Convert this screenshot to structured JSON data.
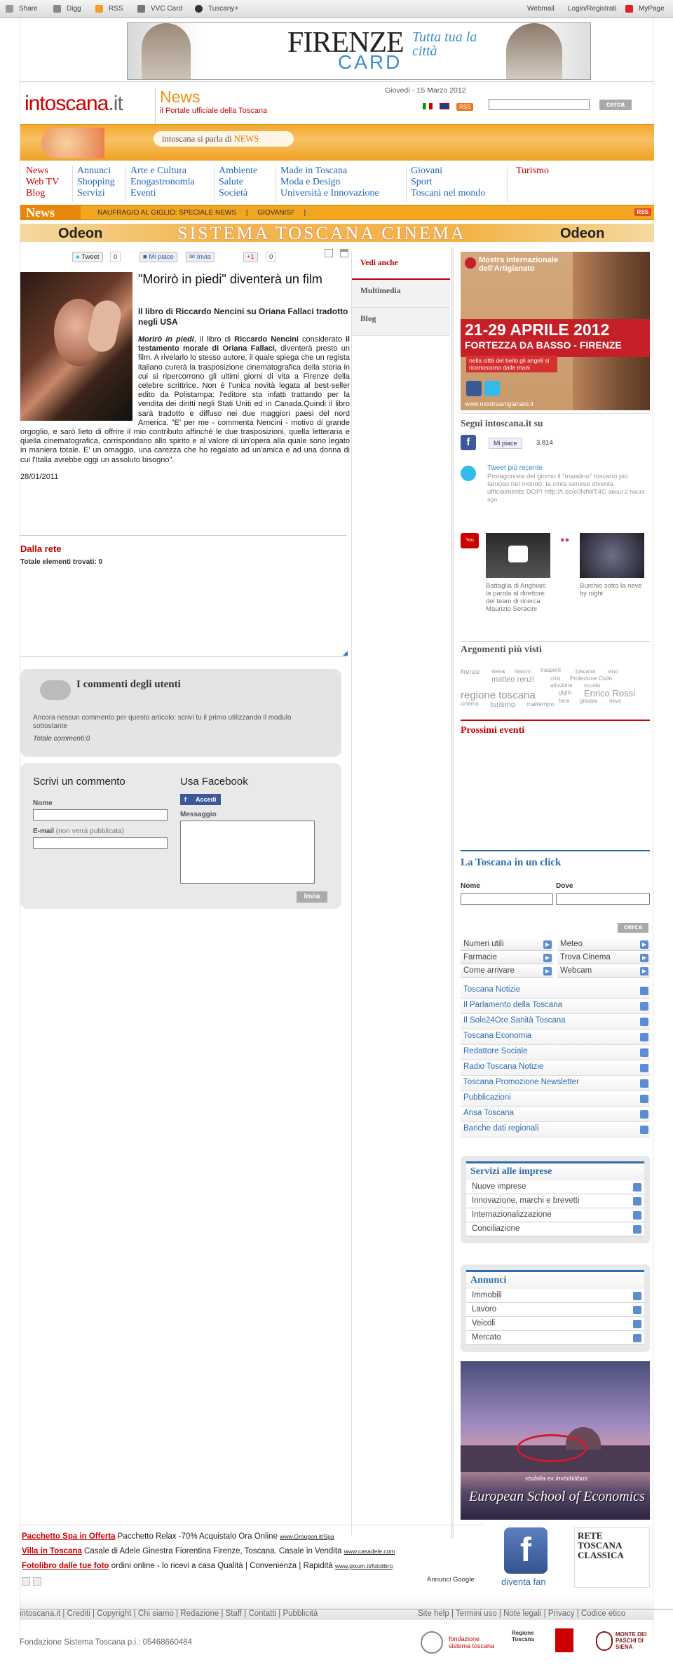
{
  "topbar": {
    "share": "Share",
    "digg": "Digg",
    "rss": "RSS",
    "vvc": "VVC Card",
    "tuscany": "Tuscany+",
    "webmail": "Webmail",
    "login": "Login/Registrati",
    "mypage": "MyPage"
  },
  "banner": {
    "firenze": "FIRENZE",
    "card": "CARD",
    "slogan": "Tutta tua la città"
  },
  "header": {
    "logo_main": "intoscana",
    "logo_tld": ".it",
    "news": "News",
    "subtitle": "il Portale ufficiale della Toscana",
    "date": "Giovedì - 15 Marzo 2012",
    "rss": "RSS",
    "search_button": "cerca"
  },
  "parla": {
    "pre": "intoscana si parla di ",
    "hl": "NEWS"
  },
  "nav": {
    "c1": [
      "News",
      "Web TV",
      "Blog"
    ],
    "c2": [
      "Annunci",
      "Shopping",
      "Servizi"
    ],
    "c3": [
      "Arte e Cultura",
      "Enogastronomia",
      "Eventi"
    ],
    "c4": [
      "Ambiente",
      "Salute",
      "Società"
    ],
    "c5": [
      "Made in Toscana",
      "Moda e Design",
      "Università e Innovazione"
    ],
    "c6": [
      "Giovani",
      "Sport",
      "Toscani nel mondo"
    ],
    "c7": [
      "Turismo"
    ]
  },
  "newsbar": {
    "label": "News",
    "ticker": "NAUFRAGIO AL GIGLIO: SPECIALE NEWS     |     GIOVANISI'     |",
    "rss": "RSS"
  },
  "cinema": {
    "text": "SISTEMA TOSCANA CINEMA",
    "odeon": "Odeon"
  },
  "share": {
    "tweet": "Tweet",
    "tweet_count": "0",
    "like": "Mi piace",
    "invia": "Invia",
    "gplus": "+1",
    "gplus_count": "0"
  },
  "article": {
    "title": "\"Morirò in piedi\" diventerà un film",
    "subtitle": "Il libro di Riccardo Nencini su Oriana Fallaci tradotto negli USA",
    "body_em": "Morirò in piedi",
    "body_1": ", il libro di ",
    "body_b1": "Riccardo Nencini",
    "body_2": " considerato ",
    "body_b2": "il testamento morale di Oriana Fallaci,",
    "body_3": " diventerà presto un film. A rivelarlo lo stesso autore, il quale spiega che un regista italiano curerà la trasposizione cinematografica della storia in cui si ripercorrono gli ultimi giorni di vita a Firenze della celebre scrittrice. Non è l'unica novità legata al best-seller edito da Polistampa: l'editore sta infatti trattando per la vendita dei diritti negli Stati Uniti ed in Canada.Quindi il libro sarà tradotto e diffuso nei due maggiori paesi del nord America. \"E' per me - commenta Nencini - motivo di grande orgoglio, e sarò lieto di offrire il mio contributo affinché le due trasposizioni, quella letteraria e quella cinematografica, corrispondano allo spirito e al valore di un'opera alla quale sono legato in maniera totale. E' un omaggio, una carezza che ho regalato ad un'amica e ad una donna di cui l'Italia avrebbe oggi un assoluto bisogno\".",
    "date": "28/01/2011"
  },
  "dallarete": {
    "title": "Dalla rete",
    "total": "Totale elementi trovati: 0"
  },
  "comments": {
    "title": "I commenti degli utenti",
    "empty": "Ancora nessun commento per questo articolo: scrivi tu il primo utilizzando il modulo sottostante",
    "total": "Totale commenti:0"
  },
  "form": {
    "title": "Scrivi un commento",
    "name": "Nome",
    "email": "E-mail",
    "email_note": " (non verrà pubblicata)",
    "fb_title": "Usa Facebook",
    "fb_btn": "Accedi",
    "msg": "Messaggio",
    "send": "Invia"
  },
  "midtabs": [
    "Vedi anche",
    "Multimedia",
    "Blog"
  ],
  "adArt": {
    "top": "Mostra Internazionale dell'Artigianato",
    "dates": "21-29 APRILE 2012",
    "place": "FORTEZZA DA BASSO - FIRENZE",
    "sub": "nella città del bello gli angeli si riconoscono dalle mani",
    "url": "www.mostraartigianato.it"
  },
  "segui": {
    "title": "Segui intoscana.it su",
    "like": "Mi piace",
    "count": "3,814",
    "tw_head": "Tweet più recente",
    "tw_text": "Protagonista del giorno il \"maialino\" toscano più famoso nel mondo: la cinta senese diventa ufficialmente DOP! http://t.co/c0NtWT4C",
    "tw_time": "about 2 hours ago"
  },
  "yt": {
    "logo": "You Tube",
    "c1": "Battaglia di Anghiari: la parola al direttore del team di ricerca Maurizio Seracini",
    "c2": "Burchio sotto la neve by night"
  },
  "tags": {
    "title": "Argomenti più visti",
    "list": [
      [
        "firenze",
        0,
        12,
        9
      ],
      [
        "siena",
        44,
        12,
        8
      ],
      [
        "lavoro",
        78,
        12,
        8
      ],
      [
        "trasporti",
        114,
        10,
        8
      ],
      [
        "toscana",
        164,
        12,
        8
      ],
      [
        "vino",
        210,
        12,
        8
      ],
      [
        "matteo renzi",
        44,
        22,
        11
      ],
      [
        "crisi",
        128,
        22,
        8
      ],
      [
        "Protezione Civile",
        156,
        22,
        8
      ],
      [
        "alluvione",
        128,
        32,
        8
      ],
      [
        "scuola",
        176,
        32,
        8
      ],
      [
        "regione toscana",
        0,
        42,
        15
      ],
      [
        "giglio",
        140,
        42,
        8
      ],
      [
        "Enrico Rossi",
        176,
        40,
        13
      ],
      [
        "treni",
        140,
        54,
        8
      ],
      [
        "giovani",
        170,
        54,
        8
      ],
      [
        "neve",
        212,
        54,
        8
      ],
      [
        "cinema",
        0,
        58,
        8
      ],
      [
        "turismo",
        42,
        58,
        11
      ],
      [
        "maltempo",
        94,
        58,
        9
      ]
    ]
  },
  "prox": {
    "title": "Prossimi eventi"
  },
  "click": {
    "title": "La Toscana in un click",
    "nome": "Nome",
    "dove": "Dove",
    "btn": "cerca"
  },
  "utili": [
    [
      "Numeri utili",
      "Meteo"
    ],
    [
      "Farmacie",
      "Trova Cinema"
    ],
    [
      "Come arrivare",
      "Webcam"
    ]
  ],
  "links": [
    "Toscana Notizie",
    "Il Parlamento della Toscana",
    "Il Sole24Ore Sanità Toscana",
    "Toscana Economia",
    "Redattore Sociale",
    "Radio Toscana Notizie",
    "Toscana Promozione Newsletter",
    "Pubblicazioni",
    "Ansa Toscana",
    "Banche dati regionali"
  ],
  "servizi": {
    "title": "Servizi alle imprese",
    "items": [
      "Nuove imprese",
      "Innovazione, marchi e brevetti",
      "Internazionalizzazione",
      "Conciliazione"
    ]
  },
  "annunci": {
    "title": "Annunci",
    "items": [
      "Immobili",
      "Lavoro",
      "Veicoli",
      "Mercato"
    ]
  },
  "ese": {
    "text": "European School of Economics",
    "visi": "visibilia ex invisibilibus"
  },
  "ads": [
    {
      "t": "Pacchetto Spa in Offerta",
      "d": " Pacchetto Relax -70% Acquistalo Ora Online ",
      "u": "www.Groupon.it/Spa"
    },
    {
      "t": "Villa in Toscana",
      "d": " Casale di Adele Ginestra Fiorentina Firenze, Toscana. Casale in Vendita ",
      "u": "www.casadele.com"
    },
    {
      "t": "Fotolibro dalle tue foto",
      "d": " ordini online - lo ricevi a casa Qualità | Convenienza | Rapidità ",
      "u": "www.pixum.it/fotolibro"
    }
  ],
  "google": "Annunci Google",
  "fan": {
    "text": "diventa fan"
  },
  "rtc": {
    "text": "RETE TOSCANA CLASSICA"
  },
  "footer": {
    "left": "intoscana.it | Crediti | Copyright | Chi siamo | Redazione | Staff | Contatti | Pubblicità",
    "right": "Site help | Termini uso | Note legali | Privacy | Codice etico",
    "piva": "Fondazione Sistema Toscana p.i.: 05468660484",
    "fst": "fondazione sistema toscana",
    "rt": "Regione Toscana",
    "mps": "MONTE DEI PASCHI DI SIENA"
  }
}
